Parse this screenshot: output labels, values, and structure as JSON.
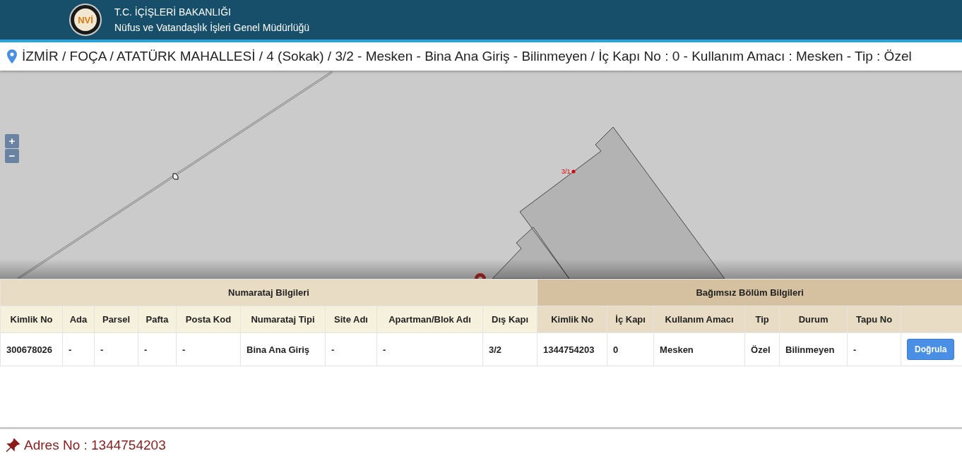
{
  "header": {
    "title": "T.C. İÇİŞLERİ BAKANLIĞI",
    "subtitle": "Nüfus ve Vatandaşlık İşleri Genel Müdürlüğü",
    "logo_text": "NVİ"
  },
  "address_bar": {
    "text": "İZMİR / FOÇA / ATATÜRK MAHALLESİ / 4 (Sokak) / 3/2 - Mesken - Bina Ana Giriş - Bilinmeyen / İç Kapı No : 0 - Kullanım Amacı : Mesken - Tip : Özel"
  },
  "map": {
    "zoom_in": "+",
    "zoom_out": "−",
    "parcel_label": "3/1"
  },
  "table": {
    "groups": [
      {
        "label": "Numarataj Bilgileri",
        "columns": [
          "Kimlik No",
          "Ada",
          "Parsel",
          "Pafta",
          "Posta Kod",
          "Numarataj Tipi",
          "Site Adı",
          "Apartman/Blok Adı",
          "Dış Kapı"
        ]
      },
      {
        "label": "Bağımsız Bölüm Bilgileri",
        "columns": [
          "Kimlik No",
          "İç Kapı",
          "Kullanım Amacı",
          "Tip",
          "Durum",
          "Tapu No"
        ]
      }
    ],
    "rows": [
      {
        "cells": [
          "300678026",
          "-",
          "-",
          "-",
          "-",
          "Bina Ana Giriş",
          "-",
          "-",
          "3/2",
          "1344754203",
          "0",
          "Mesken",
          "Özel",
          "Bilinmeyen",
          "-"
        ],
        "action": "Doğrula"
      }
    ]
  },
  "footer": {
    "text": "Adres No : 1344754203"
  }
}
